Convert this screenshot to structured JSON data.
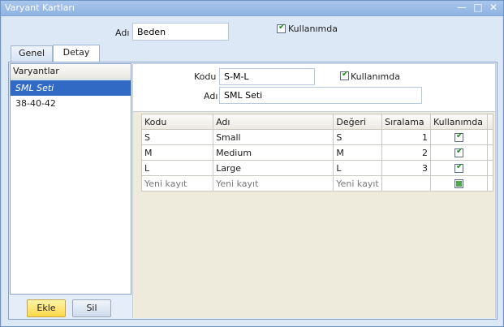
{
  "window": {
    "title": "Varyant Kartları"
  },
  "top": {
    "name_label": "Adı",
    "name_value": "Beden",
    "in_use_label": "Kullanımda",
    "in_use_checked": true
  },
  "tabs": [
    {
      "label": "Genel"
    },
    {
      "label": "Detay"
    }
  ],
  "variants": {
    "header": "Varyantlar",
    "items": [
      {
        "label": "SML Seti",
        "selected": true
      },
      {
        "label": "38-40-42",
        "selected": false
      }
    ]
  },
  "buttons": {
    "add": "Ekle",
    "delete": "Sil"
  },
  "detail": {
    "code_label": "Kodu",
    "code_value": "S-M-L",
    "name_label": "Adı",
    "name_value": "SML Seti",
    "in_use_label": "Kullanımda",
    "in_use_checked": true
  },
  "grid": {
    "columns": [
      "Kodu",
      "Adı",
      "Değeri",
      "Sıralama",
      "Kullanımda"
    ],
    "rows": [
      {
        "code": "S",
        "name": "Small",
        "value": "S",
        "order": "1",
        "in_use": true
      },
      {
        "code": "M",
        "name": "Medium",
        "value": "M",
        "order": "2",
        "in_use": true
      },
      {
        "code": "L",
        "name": "Large",
        "value": "L",
        "order": "3",
        "in_use": true
      }
    ],
    "new_row": {
      "code": "Yeni kayıt",
      "name": "Yeni kayıt",
      "value": "Yeni kayıt"
    }
  },
  "icons": {
    "minimize": "minimize-icon",
    "maximize": "maximize-icon",
    "close": "close-icon",
    "check": "check-icon"
  }
}
